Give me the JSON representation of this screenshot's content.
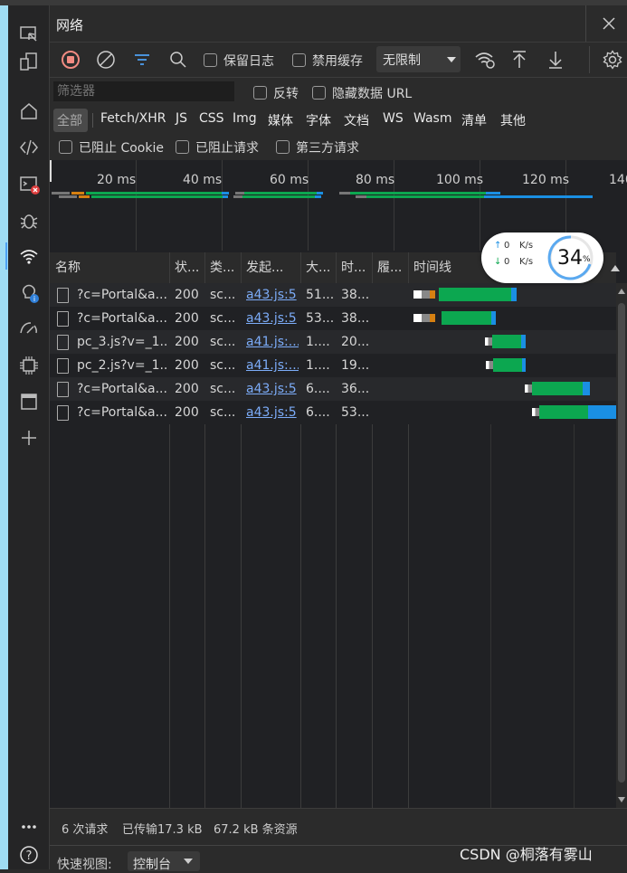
{
  "panel_title": "网络",
  "toolbar": {
    "preserve_log": "保留日志",
    "disable_cache": "禁用缓存",
    "throttle": "无限制"
  },
  "filter": {
    "placeholder": "筛选器",
    "invert": "反转",
    "hide_data_urls": "隐藏数据 URL",
    "types": [
      "全部",
      "Fetch/XHR",
      "JS",
      "CSS",
      "Img",
      "媒体",
      "字体",
      "文档",
      "WS",
      "Wasm",
      "清单",
      "其他"
    ],
    "blocked_cookies": "已阻止 Cookie",
    "blocked_requests": "已阻止请求",
    "third_party": "第三方请求"
  },
  "overview_ticks": [
    "20 ms",
    "40 ms",
    "60 ms",
    "80 ms",
    "100 ms",
    "120 ms",
    "140"
  ],
  "speed_widget": {
    "up": "0",
    "down": "0",
    "unit": "K/s",
    "percent": "34",
    "percent_sign": "%"
  },
  "columns": [
    "名称",
    "状...",
    "类...",
    "发起...",
    "大...",
    "时...",
    "履...",
    "时间线"
  ],
  "rows": [
    {
      "name": "?c=Portal&a...",
      "status": "200",
      "type": "sc...",
      "initiator": "a43.js:5",
      "size": "51...",
      "time": "38..."
    },
    {
      "name": "?c=Portal&a...",
      "status": "200",
      "type": "sc...",
      "initiator": "a43.js:5",
      "size": "53...",
      "time": "38..."
    },
    {
      "name": "pc_3.js?v=_1...",
      "status": "200",
      "type": "sc...",
      "initiator": "a41.js:...",
      "size": "1....",
      "time": "20..."
    },
    {
      "name": "pc_2.js?v=_1...",
      "status": "200",
      "type": "sc...",
      "initiator": "a41.js:...",
      "size": "1....",
      "time": "19..."
    },
    {
      "name": "?c=Portal&a...",
      "status": "200",
      "type": "sc...",
      "initiator": "a43.js:5",
      "size": "6....",
      "time": "36..."
    },
    {
      "name": "?c=Portal&a...",
      "status": "200",
      "type": "sc...",
      "initiator": "a43.js:5",
      "size": "6....",
      "time": "53..."
    }
  ],
  "status_bar": {
    "requests": "6 次请求",
    "transferred": "已传输17.3 kB",
    "resources": "67.2 kB 条资源"
  },
  "quick_view": {
    "label": "快速视图:",
    "value": "控制台"
  },
  "watermark": "CSDN @桐落有雾山",
  "colors": {
    "accent_link": "#7cacf8",
    "record_red": "#f28b82",
    "waterfall_green": "#0ca750",
    "waterfall_blue": "#1a8fe3",
    "waterfall_orange": "#d68012"
  }
}
